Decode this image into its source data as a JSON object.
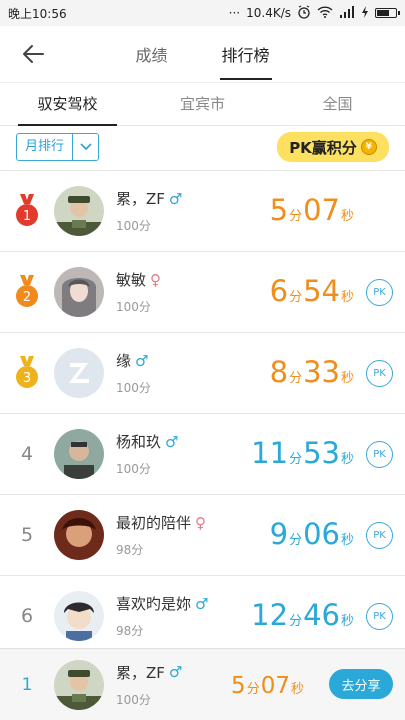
{
  "status": {
    "time": "晚上10:56",
    "dots": "···",
    "speed": "10.4K/s"
  },
  "nav": {
    "tabs": [
      "成绩",
      "排行榜"
    ],
    "active_tab": 1
  },
  "scope_tabs": [
    "驭安驾校",
    "宜宾市",
    "全国"
  ],
  "filter": {
    "period": "月排行",
    "pk_banner": "PK赢积分",
    "coin": "¥"
  },
  "colors": {
    "accent": "#2aa8d8",
    "orange": "#f08e1c",
    "gold": "#f0b21c",
    "red_medal": "#e23b2e",
    "orange_medal": "#f08a1c"
  },
  "entries": [
    {
      "rank": "1",
      "medal": "red",
      "name": "累，ZF",
      "gender": "male",
      "gender_symbol": "♂",
      "points": "100分",
      "min": "5",
      "sec": "07",
      "min_unit": "分",
      "sec_unit": "秒",
      "time_color": "orange",
      "pk": ""
    },
    {
      "rank": "2",
      "medal": "orange",
      "name": "敏敏",
      "gender": "female",
      "gender_symbol": "♀",
      "points": "100分",
      "min": "6",
      "sec": "54",
      "min_unit": "分",
      "sec_unit": "秒",
      "time_color": "orange",
      "pk": "PK"
    },
    {
      "rank": "3",
      "medal": "gold",
      "name": "缘",
      "gender": "male",
      "gender_symbol": "♂",
      "points": "100分",
      "min": "8",
      "sec": "33",
      "min_unit": "分",
      "sec_unit": "秒",
      "time_color": "orange",
      "pk": "PK"
    },
    {
      "rank": "4",
      "medal": "",
      "name": "杨和玖",
      "gender": "male",
      "gender_symbol": "♂",
      "points": "100分",
      "min": "11",
      "sec": "53",
      "min_unit": "分",
      "sec_unit": "秒",
      "time_color": "blue",
      "pk": "PK"
    },
    {
      "rank": "5",
      "medal": "",
      "name": "最初的陪伴",
      "gender": "female",
      "gender_symbol": "♀",
      "points": "98分",
      "min": "9",
      "sec": "06",
      "min_unit": "分",
      "sec_unit": "秒",
      "time_color": "blue",
      "pk": "PK"
    },
    {
      "rank": "6",
      "medal": "",
      "name": "喜欢旳是妳",
      "gender": "male",
      "gender_symbol": "♂",
      "points": "98分",
      "min": "12",
      "sec": "46",
      "min_unit": "分",
      "sec_unit": "秒",
      "time_color": "blue",
      "pk": "PK"
    }
  ],
  "my_entry": {
    "rank": "1",
    "name": "累，ZF",
    "gender_symbol": "♂",
    "points": "100分",
    "min": "5",
    "sec": "07",
    "min_unit": "分",
    "sec_unit": "秒",
    "share": "去分享"
  }
}
